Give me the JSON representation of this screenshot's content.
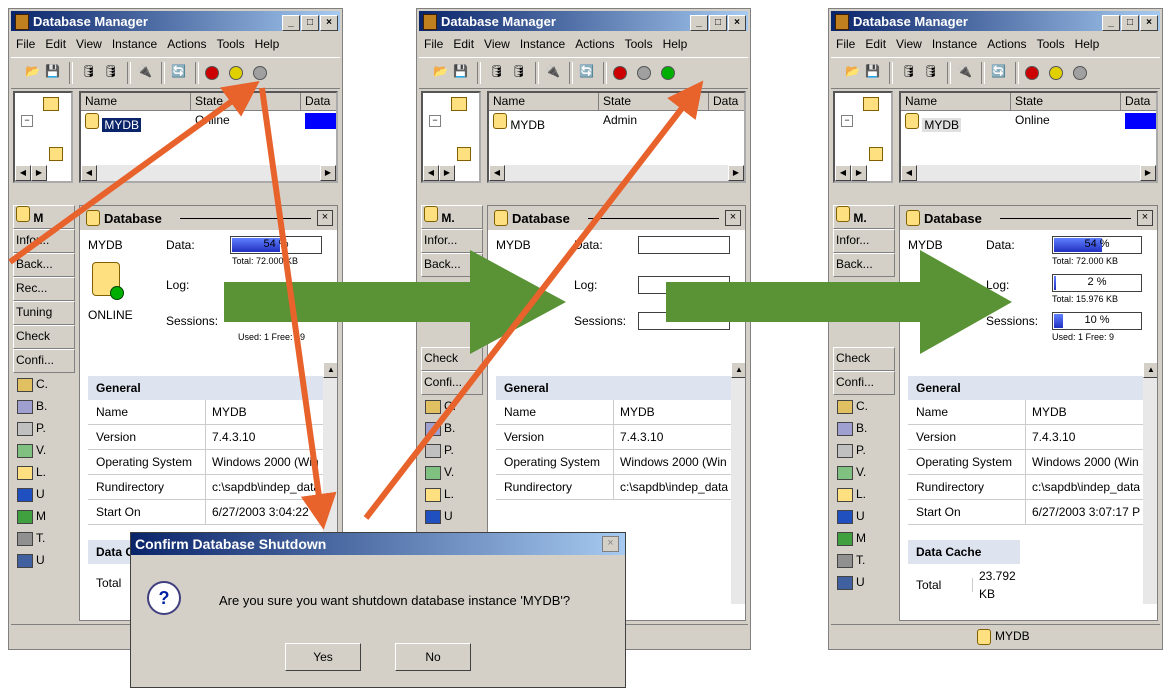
{
  "windows": [
    {
      "title": "Database Manager",
      "menu": [
        "File",
        "Edit",
        "View",
        "Instance",
        "Actions",
        "Tools",
        "Help"
      ],
      "columns": [
        "Name",
        "State",
        "Data"
      ],
      "row": {
        "name": "MYDB",
        "state": "Online",
        "data_indicator": true
      },
      "sidebar_tabs": [
        "Infor...",
        "Back...",
        "Rec...",
        "Tuning",
        "Check",
        "Confi..."
      ],
      "sidebar_icons": [
        "C.",
        "B.",
        "P.",
        "V.",
        "L.",
        "U",
        "M",
        "T.",
        "U"
      ],
      "panel_title": "Database",
      "db_name": "MYDB",
      "status": "ONLINE",
      "data_label": "Data:",
      "log_label": "Log:",
      "sessions_label": "Sessions:",
      "data_gauge": "54 %",
      "data_fraction": 0.54,
      "data_total": "Total: 72.000 KB",
      "sessions_used": "Used: 1 Free: 49",
      "general": {
        "header": "General",
        "rows": [
          [
            "Name",
            "MYDB"
          ],
          [
            "Version",
            "7.4.3.10"
          ],
          [
            "Operating System",
            "Windows 2000 (Win"
          ],
          [
            "Rundirectory",
            "c:\\sapdb\\indep_data"
          ],
          [
            "Start On",
            "6/27/2003 3:04:22"
          ]
        ]
      },
      "data_cache_header": "Data C",
      "data_cache_total": "Total"
    },
    {
      "title": "Database Manager",
      "menu": [
        "File",
        "Edit",
        "View",
        "Instance",
        "Actions",
        "Tools",
        "Help"
      ],
      "columns": [
        "Name",
        "State",
        "Data"
      ],
      "row": {
        "name": "MYDB",
        "state": "Admin",
        "data_indicator": false
      },
      "sidebar_tabs": [
        "Infor...",
        "Back..."
      ],
      "sidebar_tabs2": [
        "Check",
        "Confi..."
      ],
      "sidebar_icons": [
        "C.",
        "B.",
        "P.",
        "V.",
        "L.",
        "U"
      ],
      "panel_title": "Database",
      "db_name": "MYDB",
      "data_label": "Data:",
      "log_label": "Log:",
      "sessions_label": "Sessions:",
      "general": {
        "header": "General",
        "rows": [
          [
            "Name",
            "MYDB"
          ],
          [
            "Version",
            "7.4.3.10"
          ],
          [
            "Operating System",
            "Windows 2000 (Win"
          ],
          [
            "Rundirectory",
            "c:\\sapdb\\indep_data"
          ]
        ]
      }
    },
    {
      "title": "Database Manager",
      "menu": [
        "File",
        "Edit",
        "View",
        "Instance",
        "Actions",
        "Tools",
        "Help"
      ],
      "columns": [
        "Name",
        "State",
        "Data"
      ],
      "row": {
        "name": "MYDB",
        "state": "Online",
        "data_indicator": true
      },
      "sidebar_tabs": [
        "Infor...",
        "Back..."
      ],
      "sidebar_tabs2": [
        "Check",
        "Confi..."
      ],
      "sidebar_icons": [
        "C.",
        "B.",
        "P.",
        "V.",
        "L.",
        "U",
        "M",
        "T.",
        "U"
      ],
      "panel_title": "Database",
      "db_name": "MYDB",
      "data_label": "Data:",
      "log_label": "Log:",
      "sessions_label": "Sessions:",
      "data_gauge": "54 %",
      "data_fraction": 0.54,
      "data_total": "Total: 72.000 KB",
      "log_gauge": "2 %",
      "log_fraction": 0.02,
      "log_total": "Total: 15.976 KB",
      "sessions_gauge": "10 %",
      "sessions_fraction": 0.1,
      "sessions_used": "Used: 1 Free: 9",
      "general": {
        "header": "General",
        "rows": [
          [
            "Name",
            "MYDB"
          ],
          [
            "Version",
            "7.4.3.10"
          ],
          [
            "Operating System",
            "Windows 2000 (Win"
          ],
          [
            "Rundirectory",
            "c:\\sapdb\\indep_data"
          ],
          [
            "Start On",
            "6/27/2003 3:07:17 P"
          ]
        ]
      },
      "data_cache_header": "Data Cache",
      "data_cache_total": "Total",
      "data_cache_value": "23.792 KB",
      "status_bar": "MYDB"
    }
  ],
  "dialog": {
    "title": "Confirm Database Shutdown",
    "message": "Are you sure you want shutdown database instance 'MYDB'?",
    "yes": "Yes",
    "no": "No"
  },
  "colors": {
    "arrow_orange": "#e8622c",
    "arrow_green": "#5a9236",
    "led_red": "#cc0000",
    "led_yellow": "#e0d000",
    "led_green": "#00b000",
    "led_gray": "#a0a0a0"
  }
}
